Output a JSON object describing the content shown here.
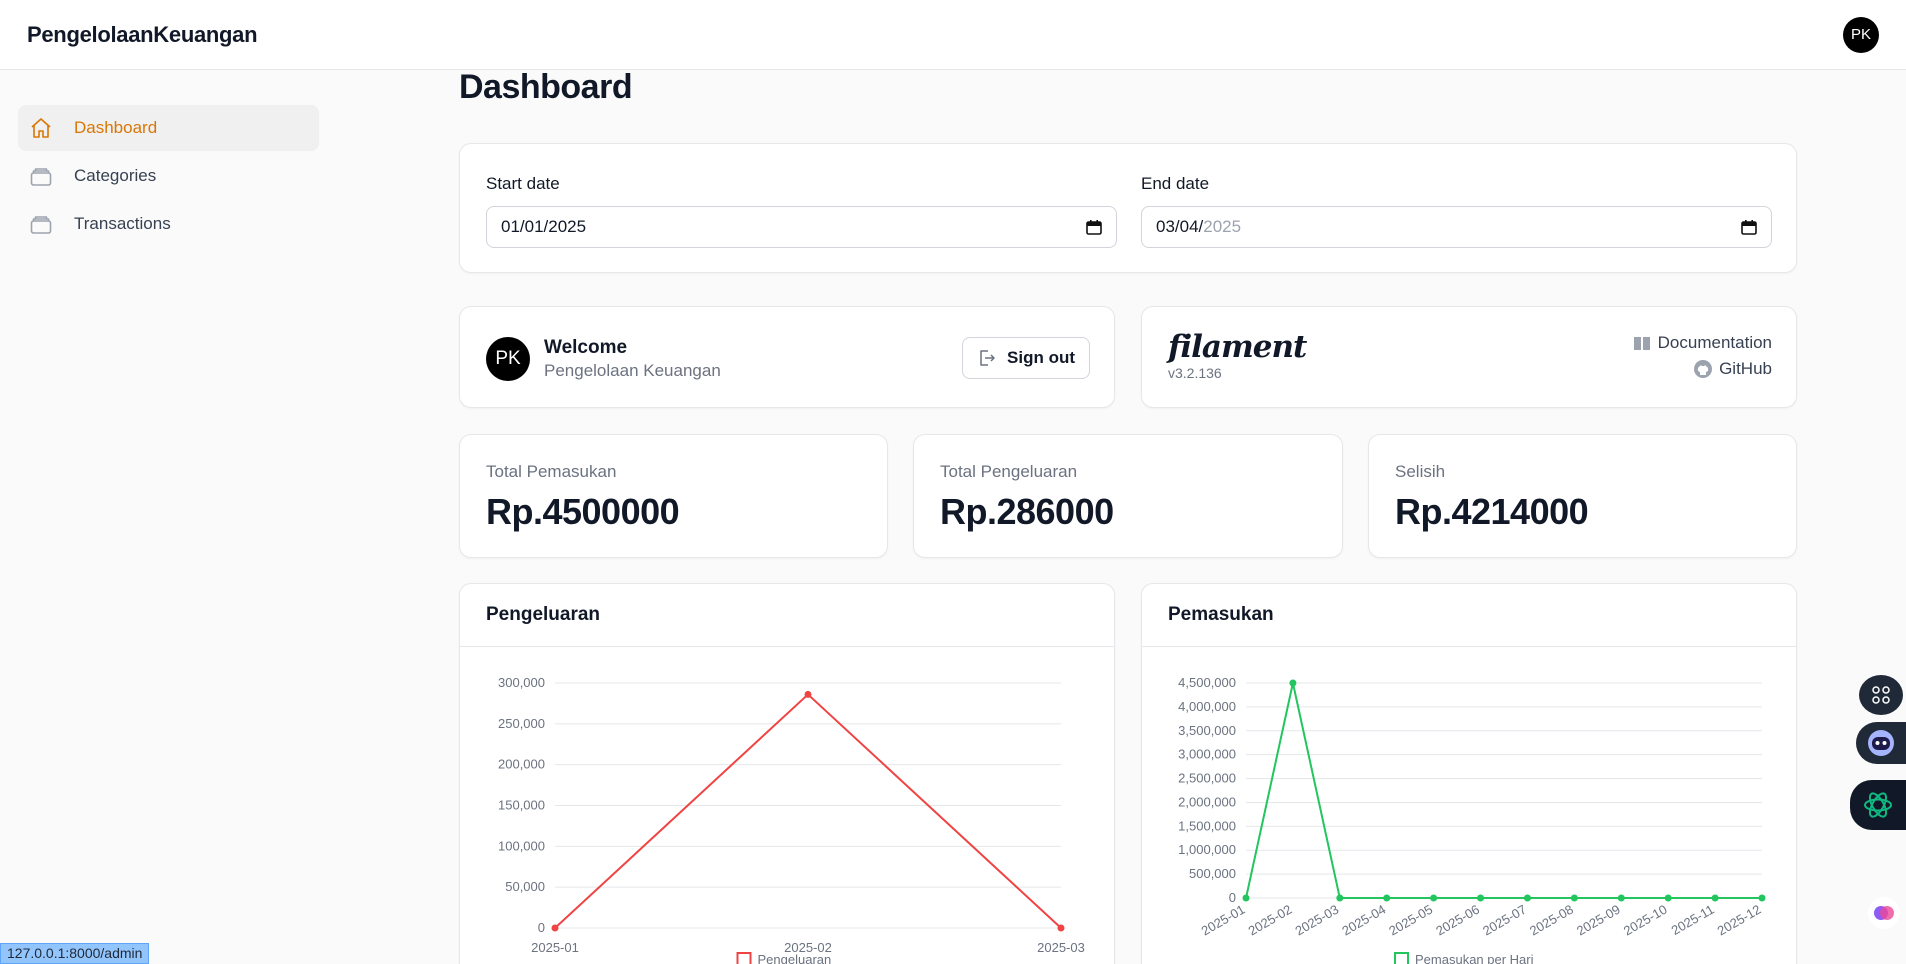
{
  "app": {
    "brand": "PengelolaanKeuangan",
    "user_initials": "PK"
  },
  "sidebar": {
    "items": [
      {
        "label": "Dashboard",
        "icon": "home-icon",
        "active": true
      },
      {
        "label": "Categories",
        "icon": "stack-icon",
        "active": false
      },
      {
        "label": "Transactions",
        "icon": "stack-icon",
        "active": false
      }
    ]
  },
  "page": {
    "title": "Dashboard"
  },
  "filters": {
    "start_label": "Start date",
    "start_value": "01/01/2025",
    "end_label": "End date",
    "end_value_day_month": "03/04/",
    "end_value_year": "2025"
  },
  "welcome": {
    "title": "Welcome",
    "name": "Pengelolaan Keuangan",
    "signout_label": "Sign out"
  },
  "filament": {
    "logo": "filament",
    "version": "v3.2.136",
    "documentation_label": "Documentation",
    "github_label": "GitHub"
  },
  "stats": [
    {
      "label": "Total Pemasukan",
      "value": "Rp.4500000"
    },
    {
      "label": "Total Pengeluaran",
      "value": "Rp.286000"
    },
    {
      "label": "Selisih",
      "value": "Rp.4214000"
    }
  ],
  "status_url": "127.0.0.1:8000/admin",
  "colors": {
    "accent": "#d97706",
    "expense": "#ef4444",
    "income": "#22c55e"
  },
  "chart_data": [
    {
      "type": "line",
      "title": "Pengeluaran",
      "x": [
        "2025-01",
        "2025-02",
        "2025-03"
      ],
      "series": [
        {
          "name": "Pengeluaran",
          "values": [
            0,
            286000,
            0
          ]
        }
      ],
      "ylim": [
        0,
        300000
      ],
      "yticks": [
        0,
        50000,
        100000,
        150000,
        200000,
        250000,
        300000
      ],
      "ytick_labels": [
        "0",
        "50,000",
        "100,000",
        "150,000",
        "200,000",
        "250,000",
        "300,000"
      ],
      "grid": true,
      "legend": "bottom"
    },
    {
      "type": "line",
      "title": "Pemasukan",
      "x": [
        "2025-01",
        "2025-02",
        "2025-03",
        "2025-04",
        "2025-05",
        "2025-06",
        "2025-07",
        "2025-08",
        "2025-09",
        "2025-10",
        "2025-11",
        "2025-12"
      ],
      "series": [
        {
          "name": "Pemasukan per Hari",
          "values": [
            0,
            4500000,
            0,
            0,
            0,
            0,
            0,
            0,
            0,
            0,
            0,
            0
          ]
        }
      ],
      "ylim": [
        0,
        4500000
      ],
      "yticks": [
        0,
        500000,
        1000000,
        1500000,
        2000000,
        2500000,
        3000000,
        3500000,
        4000000,
        4500000
      ],
      "ytick_labels": [
        "0",
        "500,000",
        "1,000,000",
        "1,500,000",
        "2,000,000",
        "2,500,000",
        "3,000,000",
        "3,500,000",
        "4,000,000",
        "4,500,000"
      ],
      "grid": true,
      "legend": "bottom"
    }
  ]
}
